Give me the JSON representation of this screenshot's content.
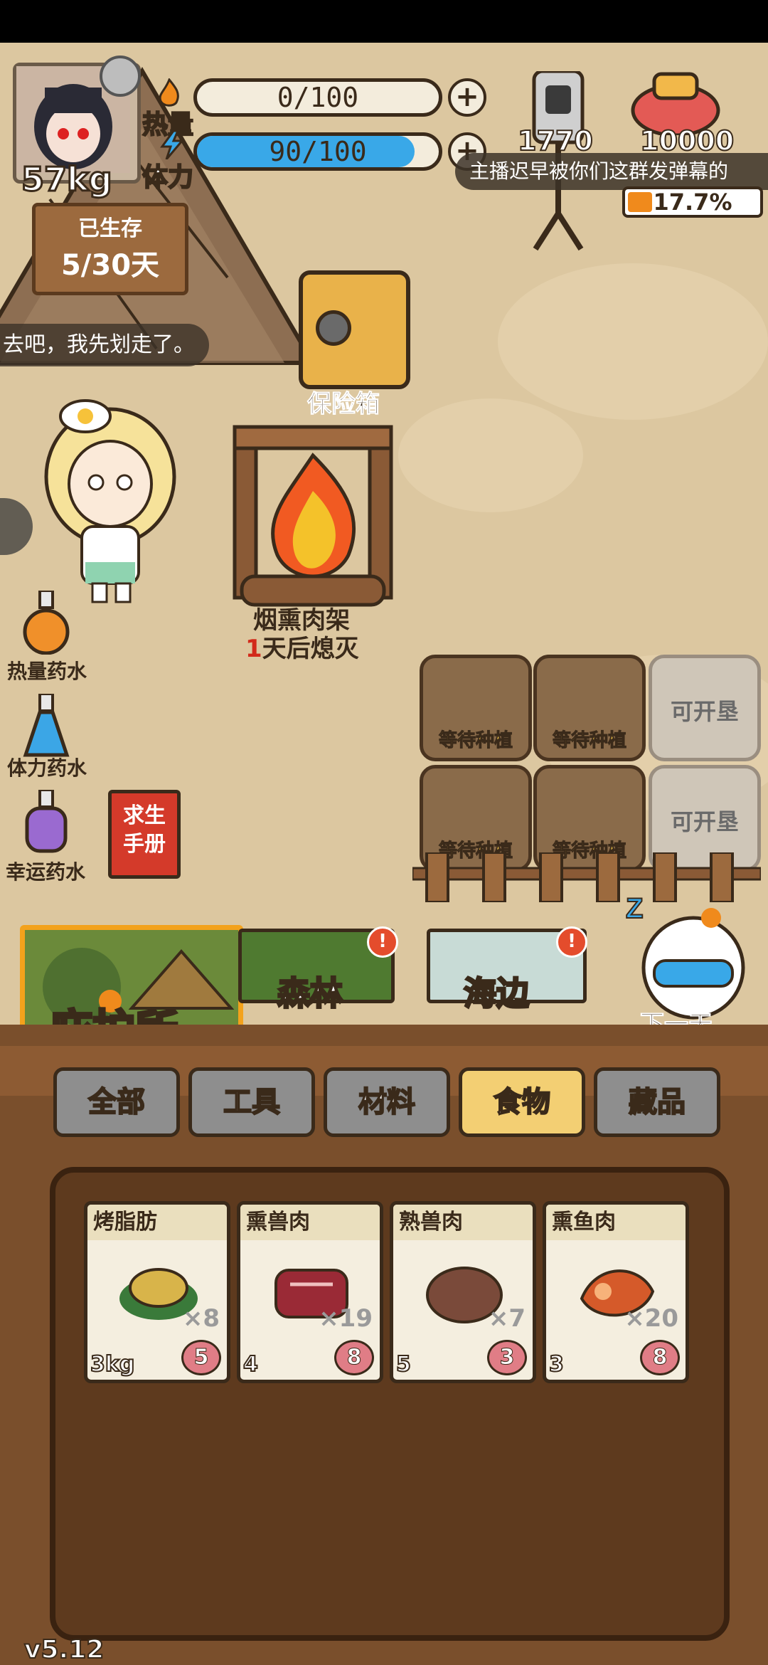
{
  "player": {
    "weight": "57kg"
  },
  "stats": {
    "heat_label": "热量",
    "heat_value": "0/100",
    "heat_level": 0.0,
    "stamina_label": "体力",
    "stamina_value": "90/100",
    "stamina_level": 0.9
  },
  "survived": {
    "title": "已生存",
    "days": "5/30天"
  },
  "stream": {
    "viewers": "1770",
    "gifts": "10000",
    "percent": "17.7%",
    "percent_level": 0.177,
    "danmaku": "主播迟早被你们这群发弹幕的"
  },
  "chat": {
    "left_message": "去吧，我先划走了。"
  },
  "safe": {
    "label": "保险箱"
  },
  "fire": {
    "name": "烟熏肉架",
    "countdown_num": "1",
    "countdown_text": "天后熄灭"
  },
  "potions": [
    {
      "label": "热量药水",
      "color": "#f0902a"
    },
    {
      "label": "体力药水",
      "color": "#3ba6e6"
    },
    {
      "label": "幸运药水",
      "color": "#9a6ad0"
    }
  ],
  "manual": {
    "line1": "求生",
    "line2": "手册"
  },
  "plots": [
    {
      "label": "等待种植",
      "free": false
    },
    {
      "label": "等待种植",
      "free": false
    },
    {
      "label": "可开垦",
      "free": true
    },
    {
      "label": "等待种植",
      "free": false
    },
    {
      "label": "等待种植",
      "free": false
    },
    {
      "label": "可开垦",
      "free": true
    }
  ],
  "locations": {
    "shelter": "庇护所",
    "forest": "森林",
    "beach": "海边",
    "alert": "!"
  },
  "next_day": "下一天",
  "tabs": [
    "全部",
    "工具",
    "材料",
    "食物",
    "藏品"
  ],
  "active_tab": 3,
  "items": [
    {
      "name": "烤脂肪",
      "count": "×8",
      "weight": "3kg",
      "value": "5"
    },
    {
      "name": "熏兽肉",
      "count": "×19",
      "weight": "4",
      "value": "8"
    },
    {
      "name": "熟兽肉",
      "count": "×7",
      "weight": "5",
      "value": "3"
    },
    {
      "name": "熏鱼肉",
      "count": "×20",
      "weight": "3",
      "value": "8"
    }
  ],
  "version": "v5.12",
  "colors": {
    "accent": "#f3cf73",
    "stamina": "#39a8e8",
    "fire": "#f4c22a",
    "alert": "#e44c2c"
  }
}
